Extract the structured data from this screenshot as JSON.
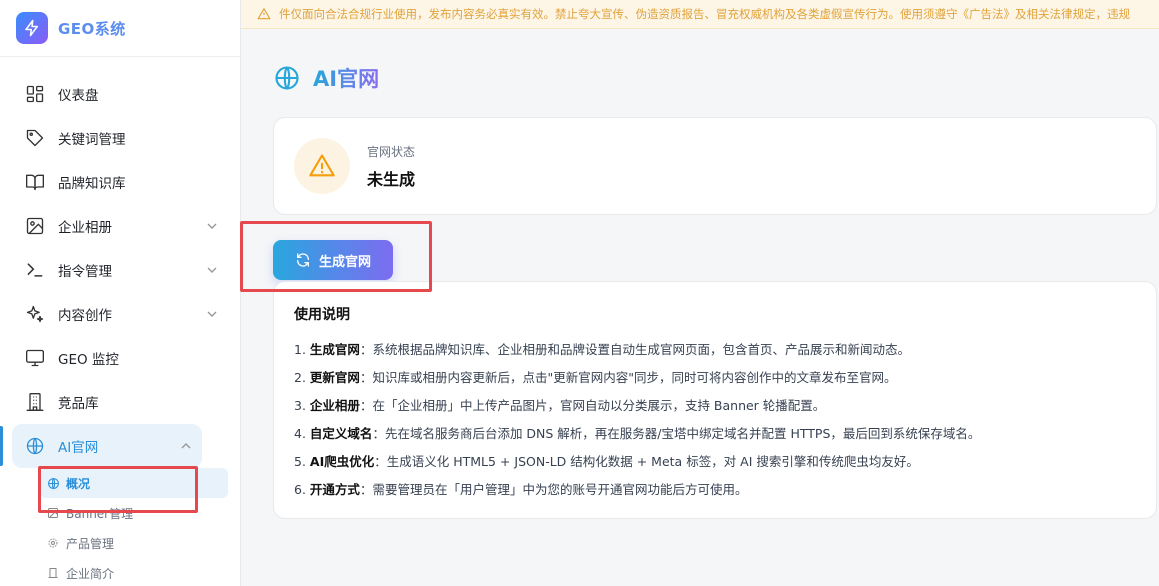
{
  "app": {
    "name": "GEO系统",
    "brand_color": "#5b8dee",
    "accent": "#2b8fd8"
  },
  "notice": {
    "text": "件仅面向合法合规行业使用，发布内容务必真实有效。禁止夸大宣传、伪造资质报告、冒充权威机构及各类虚假宣传行为。使用须遵守《广告法》及相关法律规定，违规"
  },
  "sidebar": {
    "items": [
      {
        "label": "仪表盘",
        "icon": "dashboard-icon"
      },
      {
        "label": "关键词管理",
        "icon": "tag-icon"
      },
      {
        "label": "品牌知识库",
        "icon": "book-icon"
      },
      {
        "label": "企业相册",
        "icon": "image-icon",
        "expandable": true
      },
      {
        "label": "指令管理",
        "icon": "terminal-icon",
        "expandable": true
      },
      {
        "label": "内容创作",
        "icon": "sparkle-icon",
        "expandable": true
      },
      {
        "label": "GEO 监控",
        "icon": "monitor-icon"
      },
      {
        "label": "竞品库",
        "icon": "building-icon"
      },
      {
        "label": "AI官网",
        "icon": "globe-icon",
        "expandable": true,
        "expanded": true,
        "active": true
      }
    ],
    "subitems": [
      {
        "label": "概况",
        "icon": "globe-icon",
        "active": true
      },
      {
        "label": "Banner管理",
        "icon": "image-icon"
      },
      {
        "label": "产品管理",
        "icon": "gear-icon"
      },
      {
        "label": "企业简介",
        "icon": "building-icon"
      }
    ]
  },
  "page": {
    "title": "AI官网"
  },
  "status": {
    "label": "官网状态",
    "value": "未生成",
    "warn_color": "#f59e0b"
  },
  "generate_button": {
    "label": "生成官网"
  },
  "instructions": {
    "title": "使用说明",
    "lines": [
      {
        "num": "1.",
        "key": "生成官网",
        "text": "：系统根据品牌知识库、企业相册和品牌设置自动生成官网页面，包含首页、产品展示和新闻动态。"
      },
      {
        "num": "2.",
        "key": "更新官网",
        "text": "：知识库或相册内容更新后，点击\"更新官网内容\"同步，同时可将内容创作中的文章发布至官网。"
      },
      {
        "num": "3.",
        "key": "企业相册",
        "text": "：在「企业相册」中上传产品图片，官网自动以分类展示，支持 Banner 轮播配置。"
      },
      {
        "num": "4.",
        "key": "自定义域名",
        "text": "：先在域名服务商后台添加 DNS 解析，再在服务器/宝塔中绑定域名并配置 HTTPS，最后回到系统保存域名。"
      },
      {
        "num": "5.",
        "key": "AI爬虫优化",
        "text": "：生成语义化 HTML5 + JSON-LD 结构化数据 + Meta 标签，对 AI 搜索引擎和传统爬虫均友好。"
      },
      {
        "num": "6.",
        "key": "开通方式",
        "text": "：需要管理员在「用户管理」中为您的账号开通官网功能后方可使用。"
      }
    ]
  }
}
